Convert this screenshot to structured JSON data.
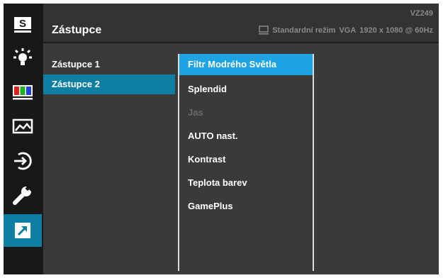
{
  "header": {
    "title": "Zástupce",
    "model": "VZ249",
    "mode": "Standardní režim",
    "input": "VGA",
    "resolution": "1920 x 1080 @ 60Hz"
  },
  "sidebar": {
    "icons": [
      {
        "name": "splendid-s-icon",
        "label": "S"
      },
      {
        "name": "blue-light-filter-icon"
      },
      {
        "name": "color-icon"
      },
      {
        "name": "image-icon"
      },
      {
        "name": "input-select-icon"
      },
      {
        "name": "system-setup-wrench-icon"
      },
      {
        "name": "shortcut-icon",
        "active": true
      }
    ]
  },
  "column1": {
    "items": [
      {
        "label": "Zástupce 1",
        "selected": false
      },
      {
        "label": "Zástupce 2",
        "selected": true
      }
    ]
  },
  "column2": {
    "items": [
      {
        "label": "Filtr Modrého Světla",
        "selected": true
      },
      {
        "label": "Splendid"
      },
      {
        "label": "Jas",
        "disabled": true
      },
      {
        "label": "AUTO nast."
      },
      {
        "label": "Kontrast"
      },
      {
        "label": "Teplota barev"
      },
      {
        "label": "GamePlus"
      }
    ]
  },
  "colors": {
    "active_blue": "#0e7fa3",
    "selected_blue": "#1ea3e3",
    "panel_bg": "#3a3a3a",
    "text_gray": "#8a8a8a"
  }
}
